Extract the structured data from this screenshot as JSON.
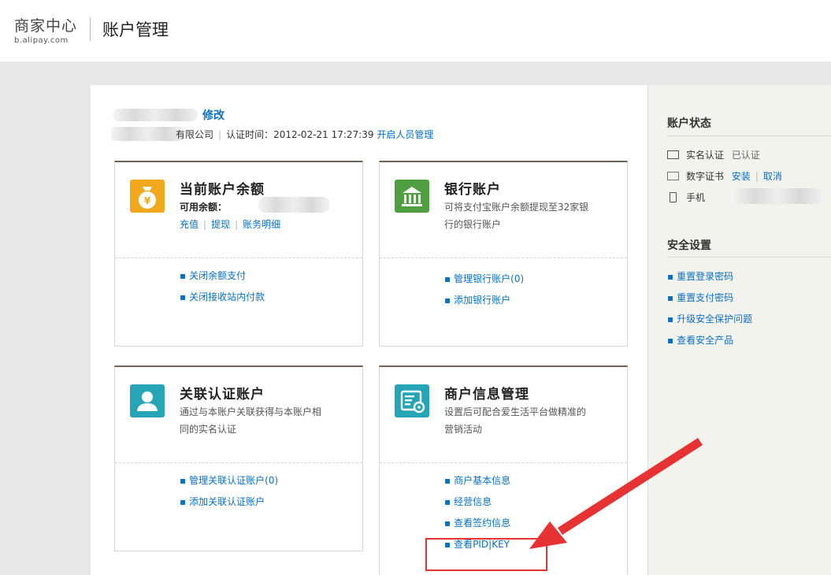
{
  "header": {
    "logo_main": "商家中心",
    "logo_sub": "b.alipay.com",
    "title": "账户管理"
  },
  "account": {
    "edit_label": "修改",
    "company_suffix": "有限公司",
    "cert_time": "认证时间：2012-02-21 17:27:39",
    "open_staff_mgmt": "开启人员管理"
  },
  "cards": {
    "balance": {
      "title": "当前账户余额",
      "available_label": "可用余额：",
      "link_recharge": "充值",
      "link_withdraw": "提现",
      "link_details": "账务明细",
      "links": [
        "关闭余额支付",
        "关闭接收站内付款"
      ],
      "icon": "money-bag-icon"
    },
    "bank": {
      "title": "银行账户",
      "desc": "可将支付宝账户余额提现至32家银行的银行账户",
      "links": [
        "管理银行账户(0)",
        "添加银行账户"
      ],
      "icon": "bank-icon"
    },
    "linked": {
      "title": "关联认证账户",
      "desc": "通过与本账户关联获得与本账户相同的实名认证",
      "links": [
        "管理关联认证账户(0)",
        "添加关联认证账户"
      ],
      "icon": "user-icon"
    },
    "merchant": {
      "title": "商户信息管理",
      "desc": "设置后可配合爱生活平台做精准的营销活动",
      "links": [
        "商户基本信息",
        "经营信息",
        "查看签约信息",
        "查看PID|KEY"
      ],
      "icon": "merchant-settings-icon"
    }
  },
  "sidebar": {
    "status_title": "账户状态",
    "realname_label": "实名认证",
    "realname_value": "已认证",
    "cert_label": "数字证书",
    "cert_install": "安装",
    "cert_cancel": "取消",
    "phone_label": "手机",
    "security_title": "安全设置",
    "security_links": [
      "重置登录密码",
      "重置支付密码",
      "升级安全保护问题",
      "查看安全产品"
    ]
  },
  "colors": {
    "link": "#0b6fbf",
    "balance_icon": "#f2a81c",
    "bank_icon": "#4f9e3f",
    "linked_icon": "#25a5b5",
    "merchant_icon": "#25a5b5",
    "annotation": "#e63232"
  }
}
